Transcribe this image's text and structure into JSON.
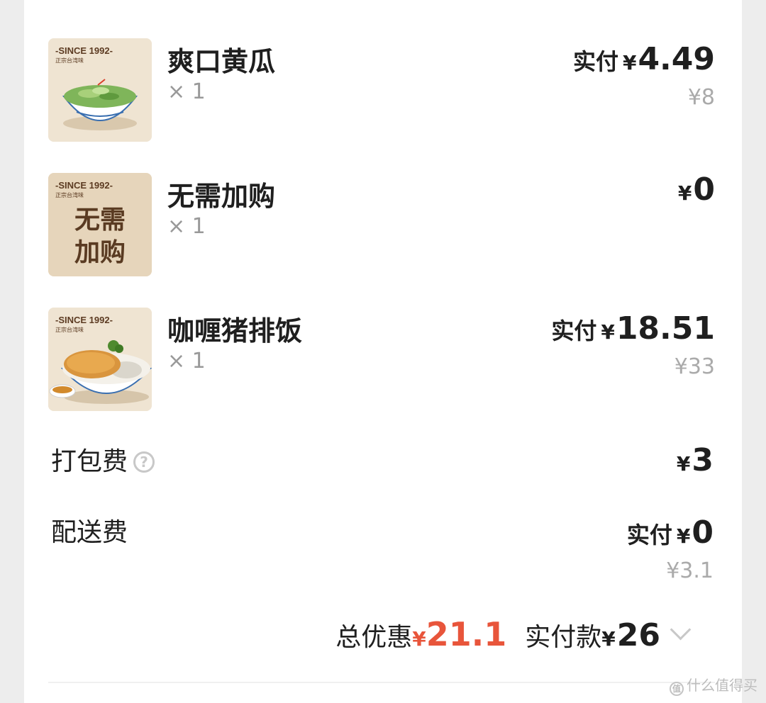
{
  "header_cut_text": "",
  "items": [
    {
      "thumb_brand": "-SINCE 1992-",
      "thumb_sub": "正宗台湾味",
      "name": "爽口黄瓜",
      "qty": "× 1",
      "paid_label": "实付",
      "currency": "¥",
      "paid_amount": "4.49",
      "original_price": "¥8"
    },
    {
      "thumb_brand": "-SINCE 1992-",
      "thumb_sub": "正宗台湾味",
      "thumb_text_line1": "无需",
      "thumb_text_line2": "加购",
      "name": "无需加购",
      "qty": "× 1",
      "currency": "¥",
      "paid_amount": "0"
    },
    {
      "thumb_brand": "-SINCE 1992-",
      "thumb_sub": "正宗台湾味",
      "name": "咖喱猪排饭",
      "qty": "× 1",
      "paid_label": "实付",
      "currency": "¥",
      "paid_amount": "18.51",
      "original_price": "¥33"
    }
  ],
  "packing_fee": {
    "label": "打包费",
    "help_icon": "question-circle-icon",
    "currency": "¥",
    "amount": "3"
  },
  "delivery_fee": {
    "label": "配送费",
    "paid_label": "实付",
    "currency": "¥",
    "amount": "0",
    "original_price": "¥3.1"
  },
  "summary": {
    "discount_label": "总优惠",
    "discount_currency": "¥",
    "discount_amount": "21.1",
    "paid_label": "实付款",
    "paid_currency": "¥",
    "paid_amount": "26",
    "expand_icon": "chevron-down-icon"
  },
  "watermark": {
    "icon": "值",
    "text": "什么值得买"
  },
  "colors": {
    "accent_discount": "#e8553b",
    "muted_text": "#aaaaaa",
    "background": "#ededed",
    "card": "#ffffff"
  }
}
